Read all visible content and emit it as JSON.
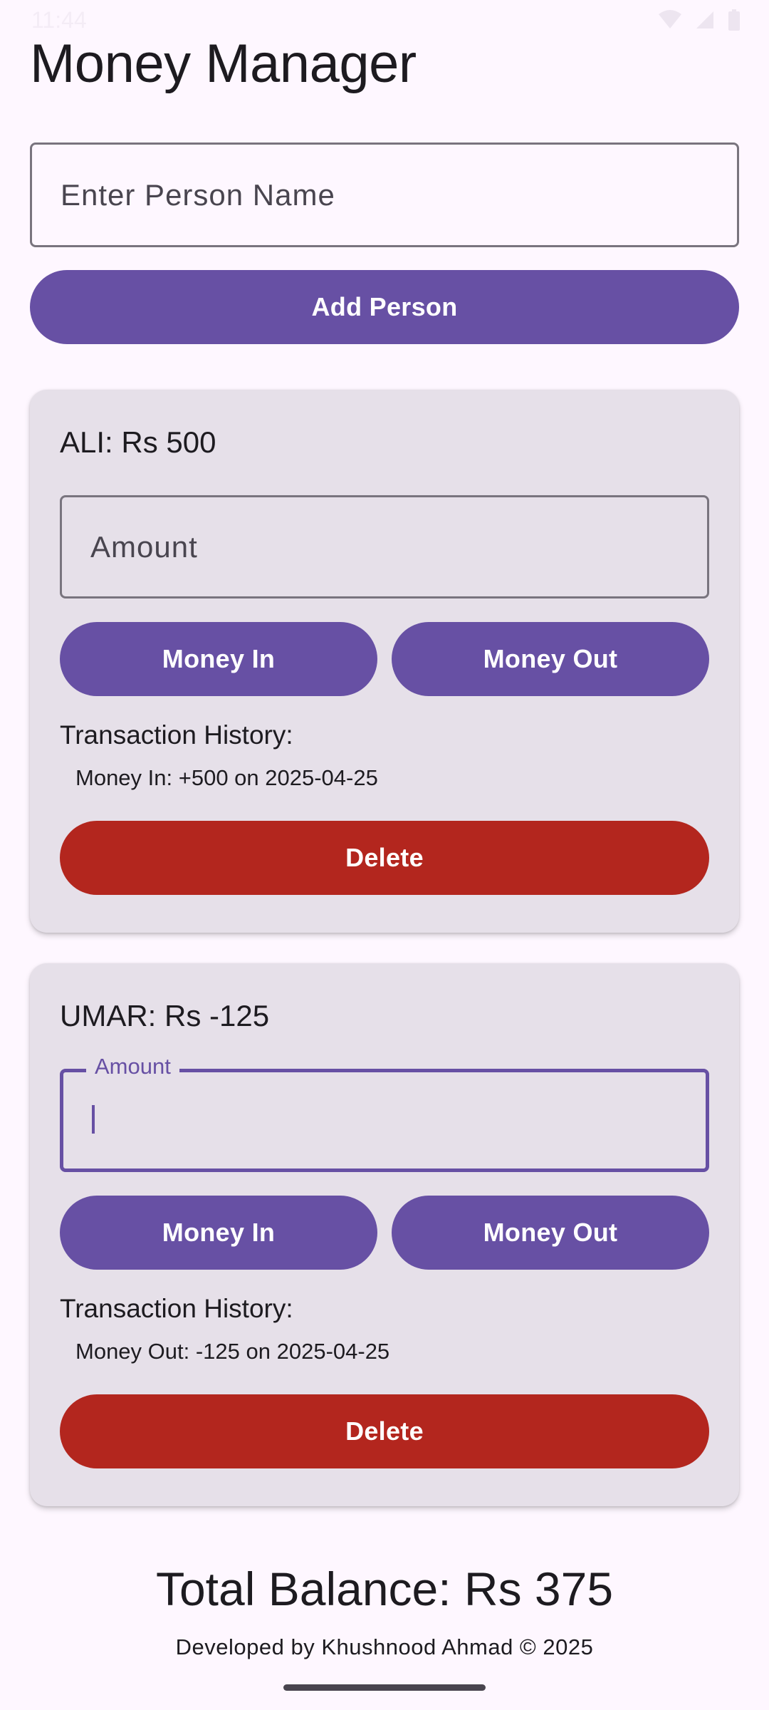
{
  "status_bar": {
    "time": "11:44"
  },
  "app": {
    "title": "Money Manager"
  },
  "add_person": {
    "input_placeholder": "Enter Person Name",
    "button_label": "Add Person"
  },
  "people": [
    {
      "title": "ALI: Rs 500",
      "amount_placeholder": "Amount",
      "money_in_label": "Money In",
      "money_out_label": "Money Out",
      "history_label": "Transaction History:",
      "history": [
        "Money In: +500 on 2025-04-25"
      ],
      "delete_label": "Delete"
    },
    {
      "title": "UMAR: Rs -125",
      "amount_label": "Amount",
      "money_in_label": "Money In",
      "money_out_label": "Money Out",
      "history_label": "Transaction History:",
      "history": [
        "Money Out: -125 on 2025-04-25"
      ],
      "delete_label": "Delete"
    }
  ],
  "footer": {
    "total": "Total Balance: Rs 375",
    "credit": "Developed by Khushnood Ahmad © 2025"
  },
  "colors": {
    "background": "#FEF7FF",
    "primary": "#6750A4",
    "card": "#E6E0E9",
    "danger": "#B3261E",
    "text": "#1D1B20"
  },
  "icons": [
    "wifi-icon",
    "signal-icon",
    "battery-icon",
    "location-icon",
    "sim-icon"
  ]
}
